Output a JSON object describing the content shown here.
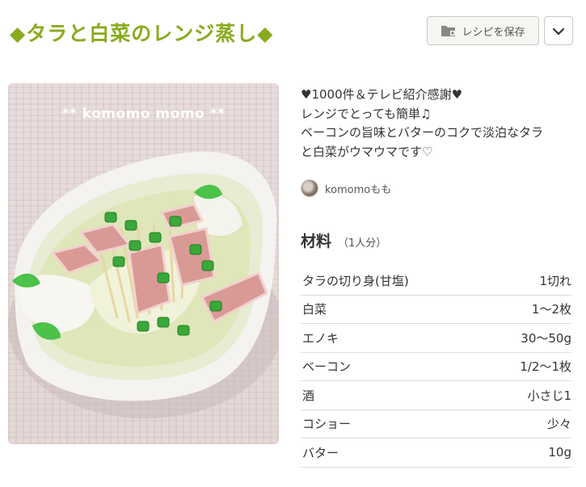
{
  "recipe": {
    "title": "◆タラと白菜のレンジ蒸し◆",
    "save_label": "レシピを保存",
    "watermark": "** komomo momo **",
    "description": [
      "♥1000件＆テレビ紹介感謝♥",
      "レンジでとっても簡単♫",
      "ベーコンの旨味とバターのコクで淡泊なタラ",
      "と白菜がウマウマです♡"
    ],
    "author": "komomoもも",
    "ingredients_title": "材料",
    "servings": "（1人分）",
    "ingredients": [
      {
        "name": "タラの切り身(甘塩)",
        "qty": "1切れ"
      },
      {
        "name": "白菜",
        "qty": "1～2枚"
      },
      {
        "name": "エノキ",
        "qty": "30～50g"
      },
      {
        "name": "ベーコン",
        "qty": "1/2～1枚"
      },
      {
        "name": "酒",
        "qty": "小さじ1"
      },
      {
        "name": "コショー",
        "qty": "少々"
      },
      {
        "name": "バター",
        "qty": "10g"
      }
    ]
  },
  "colors": {
    "title": "#8aab1e",
    "button_bg": "#f6f6f2",
    "border": "#c8c8c8"
  },
  "icons": {
    "save": "folder-plus-icon",
    "menu": "chevron-down-icon"
  }
}
